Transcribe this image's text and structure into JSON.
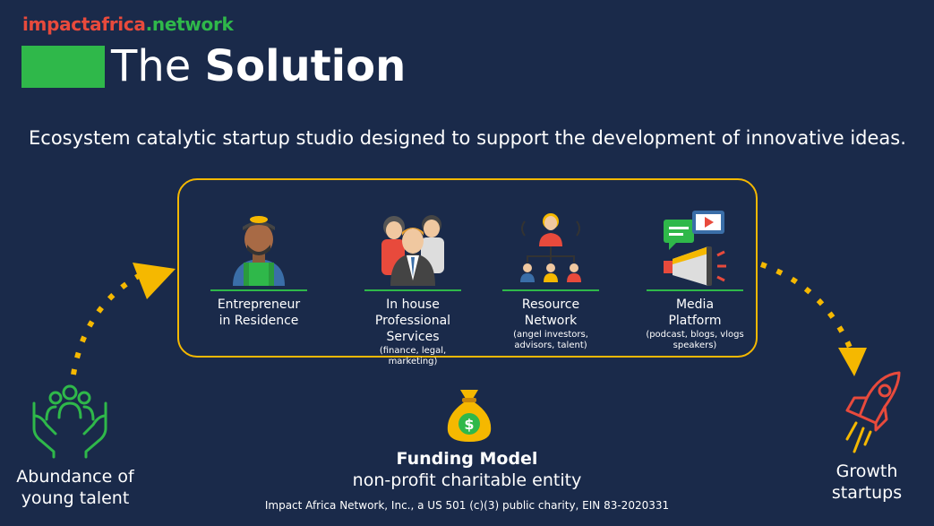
{
  "logo": {
    "part1": "impactafrica",
    "dot": ".",
    "part2": "network"
  },
  "title": {
    "light": "The ",
    "bold": "Solution"
  },
  "subtitle": "Ecosystem catalytic startup studio designed to support the development of innovative ideas.",
  "items": [
    {
      "label": "Entrepreneur\nin Residence",
      "sub": "",
      "icon": "entrepreneur-icon"
    },
    {
      "label": "In house\nProfessional\nServices",
      "sub": "(finance, legal, marketing)",
      "icon": "team-icon"
    },
    {
      "label": "Resource\nNetwork",
      "sub": "(angel investors,\nadvisors, talent)",
      "icon": "network-icon"
    },
    {
      "label": "Media\nPlatform",
      "sub": "(podcast, blogs, vlogs\nspeakers)",
      "icon": "media-icon"
    }
  ],
  "left_label": "Abundance of\nyoung talent",
  "right_label": "Growth\nstartups",
  "funding": {
    "title": "Funding Model",
    "subtitle": "non-profit charitable entity"
  },
  "footer": "Impact Africa Network, Inc., a US 501 (c)(3) public charity, EIN 83-2020331",
  "colors": {
    "background": "#1a2a4a",
    "accent_green": "#2fb84a",
    "accent_yellow": "#f5b800"
  }
}
